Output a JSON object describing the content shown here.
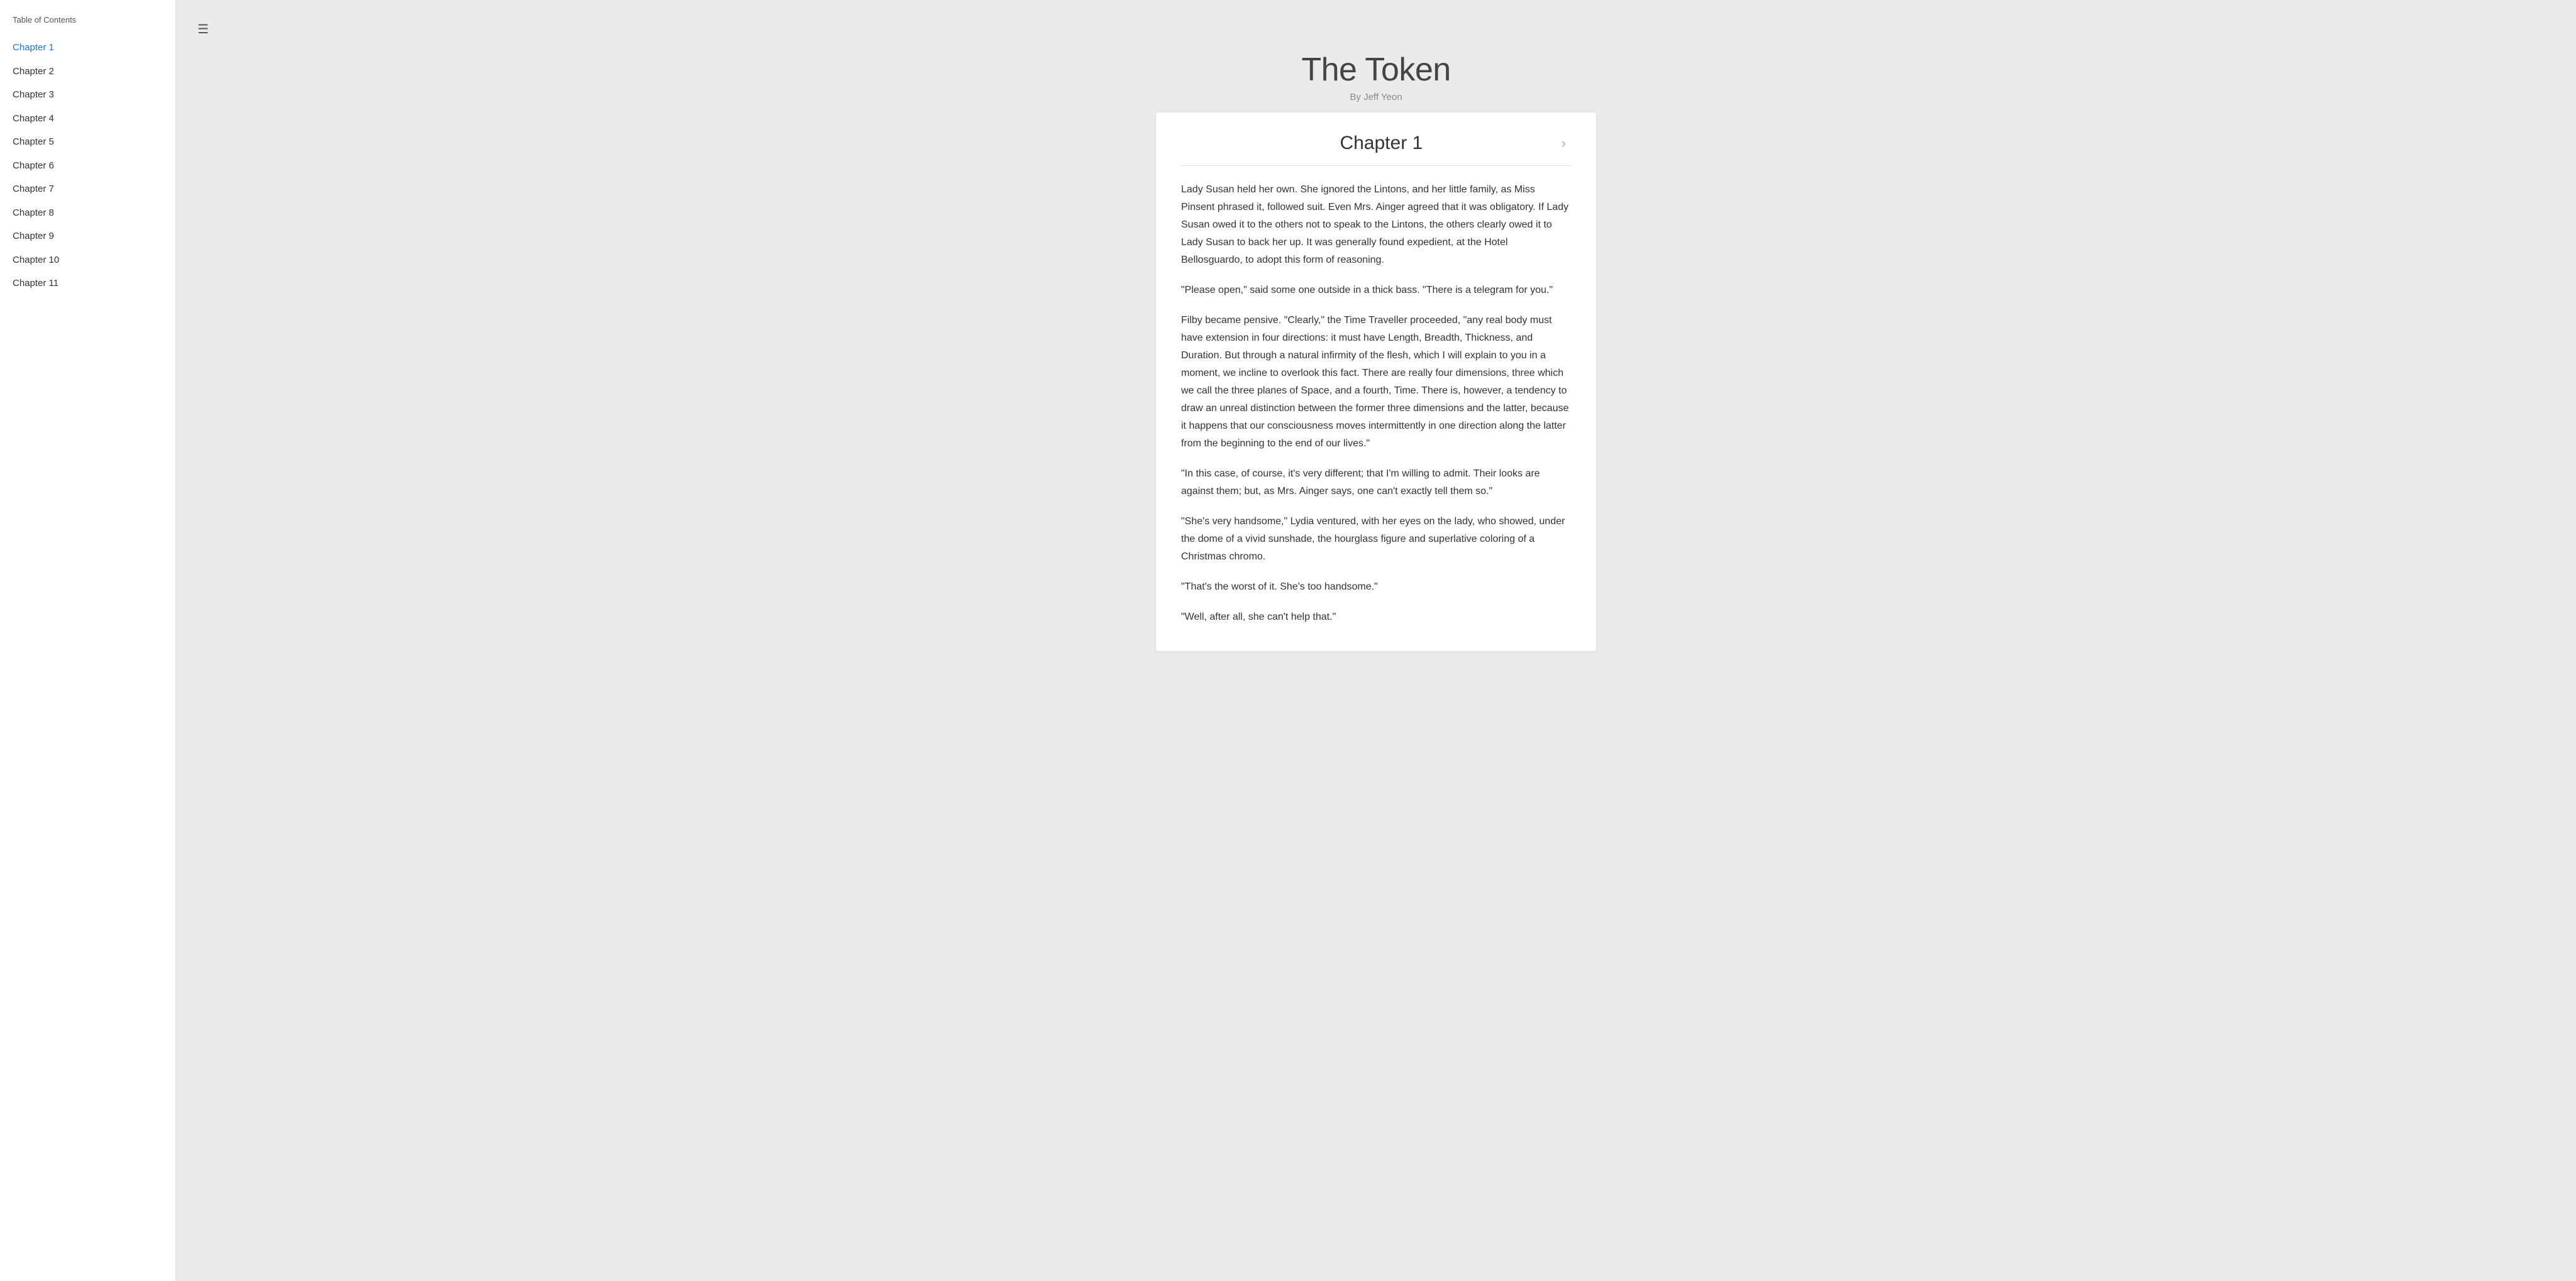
{
  "sidebar": {
    "title": "Table of Contents",
    "items": [
      {
        "label": "Chapter 1",
        "active": true
      },
      {
        "label": "Chapter 2",
        "active": false
      },
      {
        "label": "Chapter 3",
        "active": false
      },
      {
        "label": "Chapter 4",
        "active": false
      },
      {
        "label": "Chapter 5",
        "active": false
      },
      {
        "label": "Chapter 6",
        "active": false
      },
      {
        "label": "Chapter 7",
        "active": false
      },
      {
        "label": "Chapter 8",
        "active": false
      },
      {
        "label": "Chapter 9",
        "active": false
      },
      {
        "label": "Chapter 10",
        "active": false
      },
      {
        "label": "Chapter 11",
        "active": false
      }
    ]
  },
  "book": {
    "title": "The Token",
    "author": "By Jeff Yeon"
  },
  "chapter": {
    "title": "Chapter 1",
    "paragraphs": [
      "Lady Susan held her own. She ignored the Lintons, and her little family, as Miss Pinsent phrased it, followed suit. Even Mrs. Ainger agreed that it was obligatory. If Lady Susan owed it to the others not to speak to the Lintons, the others clearly owed it to Lady Susan to back her up. It was generally found expedient, at the Hotel Bellosguardo, to adopt this form of reasoning.",
      "\"Please open,\" said some one outside in a thick bass. \"There is a telegram for you.\"",
      "Filby became pensive. \"Clearly,\" the Time Traveller proceeded, \"any real body must have extension in four directions: it must have Length, Breadth, Thickness, and Duration. But through a natural infirmity of the flesh, which I will explain to you in a moment, we incline to overlook this fact. There are really four dimensions, three which we call the three planes of Space, and a fourth, Time. There is, however, a tendency to draw an unreal distinction between the former three dimensions and the latter, because it happens that our consciousness moves intermittently in one direction along the latter from the beginning to the end of our lives.\"",
      "\"In this case, of course, it's very different; that I'm willing to admit. Their looks are against them; but, as Mrs. Ainger says, one can't exactly tell them so.\"",
      "\"She's very handsome,\" Lydia ventured, with her eyes on the lady, who showed, under the dome of a vivid sunshade, the hourglass figure and superlative coloring of a Christmas chromo.",
      "\"That's the worst of it. She's too handsome.\"",
      "\"Well, after all, she can't help that.\""
    ]
  },
  "icons": {
    "menu": "☰",
    "next": "›"
  }
}
